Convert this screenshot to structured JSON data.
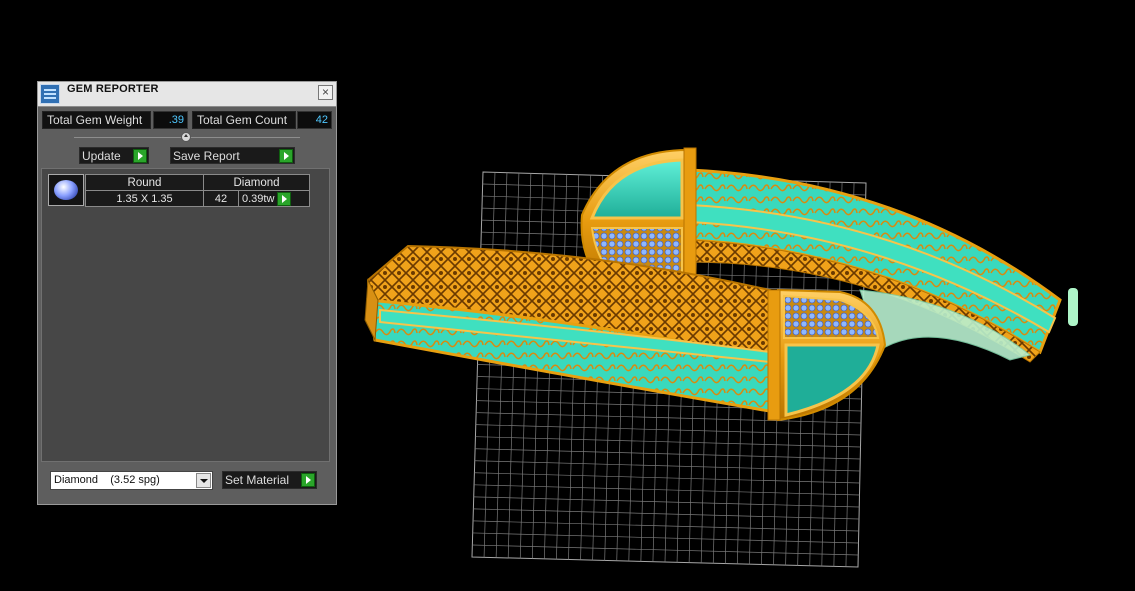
{
  "panel": {
    "title": "GEM REPORTER",
    "close_label": "×",
    "total_weight_label": "Total Gem Weight",
    "total_weight_value": ".39",
    "total_count_label": "Total Gem Count",
    "total_count_value": "42",
    "update_label": "Update",
    "save_report_label": "Save Report",
    "gem_rows": [
      {
        "shape": "Round",
        "material": "Diamond",
        "size": "1.35 X 1.35",
        "count": "42",
        "weight": "0.39tw"
      }
    ],
    "material_select": {
      "value": "Diamond    (3.52 spg)"
    },
    "set_material_label": "Set Material"
  },
  "colors": {
    "gold": "#f2a81d",
    "turquoise": "#3fe0c0",
    "grid": "#9a9a9a",
    "go_green": "#2aa52a",
    "value_blue": "#4fc8ff"
  }
}
